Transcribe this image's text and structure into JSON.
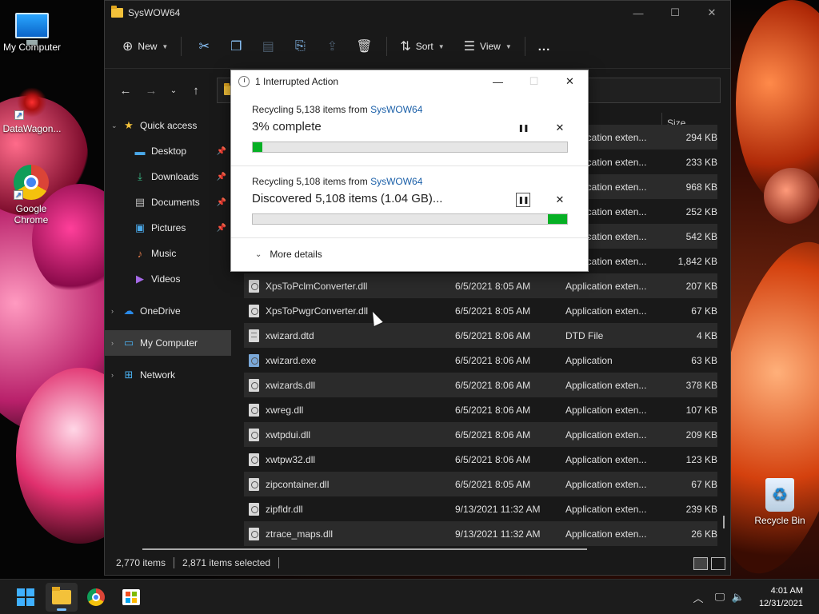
{
  "desktop": {
    "icons": [
      {
        "label": "My Computer"
      },
      {
        "label": "DataWagon..."
      },
      {
        "label": "Google Chrome"
      },
      {
        "label": "Recycle Bin"
      }
    ]
  },
  "explorer": {
    "title": "SysWOW64",
    "toolbar": {
      "new_label": "New",
      "sort_label": "Sort",
      "view_label": "View",
      "more_label": "..."
    },
    "sidebar": {
      "quick_access": "Quick access",
      "items": [
        {
          "label": "Desktop"
        },
        {
          "label": "Downloads"
        },
        {
          "label": "Documents"
        },
        {
          "label": "Pictures"
        },
        {
          "label": "Music"
        },
        {
          "label": "Videos"
        }
      ],
      "onedrive": "OneDrive",
      "my_computer": "My Computer",
      "network": "Network"
    },
    "columns": {
      "size": "Size"
    },
    "files": [
      {
        "name": "",
        "date": "",
        "type": "Application exten...",
        "size": "294 KB"
      },
      {
        "name": "",
        "date": "",
        "type": "Application exten...",
        "size": "233 KB"
      },
      {
        "name": "",
        "date": "",
        "type": "Application exten...",
        "size": "968 KB"
      },
      {
        "name": "",
        "date": "",
        "type": "Application exten...",
        "size": "252 KB"
      },
      {
        "name": "",
        "date": "",
        "type": "Application exten...",
        "size": "542 KB"
      },
      {
        "name": "",
        "date": "",
        "type": "Application exten...",
        "size": "1,842 KB"
      },
      {
        "name": "XpsToPclmConverter.dll",
        "date": "6/5/2021 8:05 AM",
        "type": "Application exten...",
        "size": "207 KB"
      },
      {
        "name": "XpsToPwgrConverter.dll",
        "date": "6/5/2021 8:05 AM",
        "type": "Application exten...",
        "size": "67 KB"
      },
      {
        "name": "xwizard.dtd",
        "date": "6/5/2021 8:06 AM",
        "type": "DTD File",
        "size": "4 KB"
      },
      {
        "name": "xwizard.exe",
        "date": "6/5/2021 8:06 AM",
        "type": "Application",
        "size": "63 KB"
      },
      {
        "name": "xwizards.dll",
        "date": "6/5/2021 8:06 AM",
        "type": "Application exten...",
        "size": "378 KB"
      },
      {
        "name": "xwreg.dll",
        "date": "6/5/2021 8:06 AM",
        "type": "Application exten...",
        "size": "107 KB"
      },
      {
        "name": "xwtpdui.dll",
        "date": "6/5/2021 8:06 AM",
        "type": "Application exten...",
        "size": "209 KB"
      },
      {
        "name": "xwtpw32.dll",
        "date": "6/5/2021 8:06 AM",
        "type": "Application exten...",
        "size": "123 KB"
      },
      {
        "name": "zipcontainer.dll",
        "date": "6/5/2021 8:05 AM",
        "type": "Application exten...",
        "size": "67 KB"
      },
      {
        "name": "zipfldr.dll",
        "date": "9/13/2021 11:32 AM",
        "type": "Application exten...",
        "size": "239 KB"
      },
      {
        "name": "ztrace_maps.dll",
        "date": "9/13/2021 11:32 AM",
        "type": "Application exten...",
        "size": "26 KB"
      }
    ],
    "status": {
      "items": "2,770 items",
      "selected": "2,871 items selected"
    }
  },
  "dialog": {
    "title": "1 Interrupted Action",
    "op1": {
      "prefix": "Recycling 5,138 items from ",
      "source": "SysWOW64",
      "status": "3% complete",
      "progress": 0.03
    },
    "op2": {
      "prefix": "Recycling 5,108 items from ",
      "source": "SysWOW64",
      "status": "Discovered 5,108 items (1.04 GB)...",
      "progress": 0.06
    },
    "more_details": "More details"
  },
  "taskbar": {
    "time": "4:01 AM",
    "date": "12/31/2021"
  },
  "colors": {
    "progress_fill": "#06b025",
    "accent": "#7ac0ff"
  }
}
